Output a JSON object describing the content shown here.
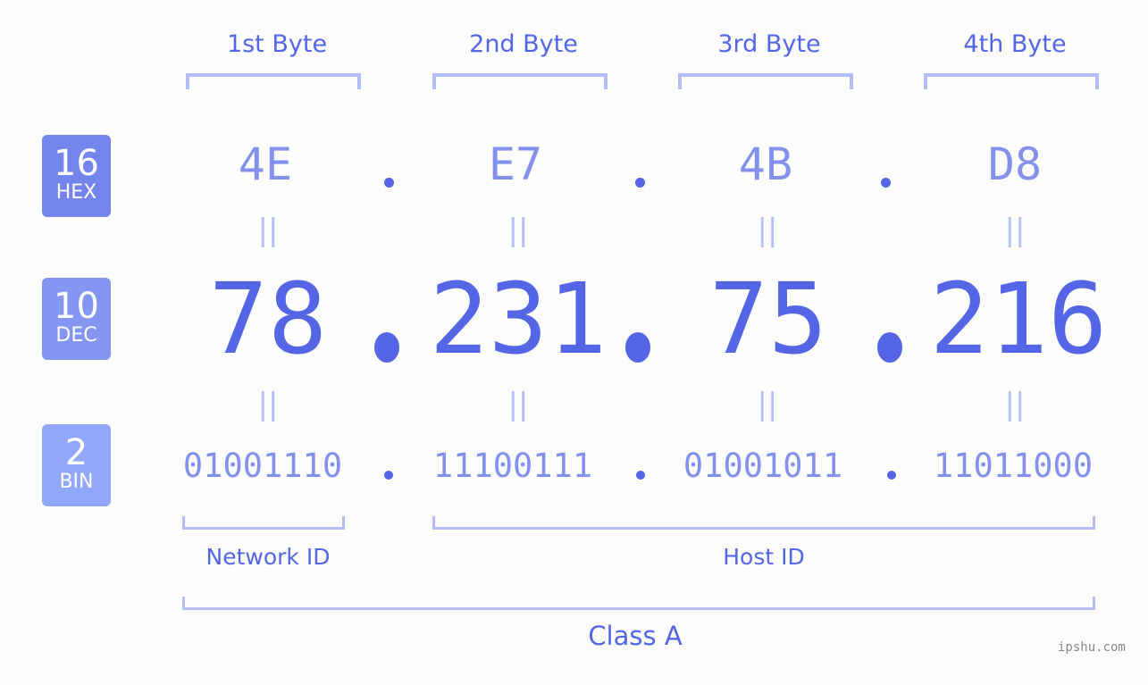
{
  "byte_headers": [
    "1st Byte",
    "2nd Byte",
    "3rd Byte",
    "4th Byte"
  ],
  "bases": [
    {
      "number": "16",
      "name": "HEX",
      "color": "#7384ec"
    },
    {
      "number": "10",
      "name": "DEC",
      "color": "#8595f2"
    },
    {
      "number": "2",
      "name": "BIN",
      "color": "#91a8fa"
    }
  ],
  "hex": [
    "4E",
    "E7",
    "4B",
    "D8"
  ],
  "dec": [
    "78",
    "231",
    "75",
    "216"
  ],
  "bin": [
    "01001110",
    "11100111",
    "01001011",
    "11011000"
  ],
  "separator": ".",
  "equals": "||",
  "network_id_label": "Network ID",
  "host_id_label": "Host ID",
  "class_label": "Class A",
  "watermark": "ipshu.com",
  "colors": {
    "accent": "#5466e6",
    "light": "#8390ec",
    "bracket": "#b4bdf6"
  }
}
